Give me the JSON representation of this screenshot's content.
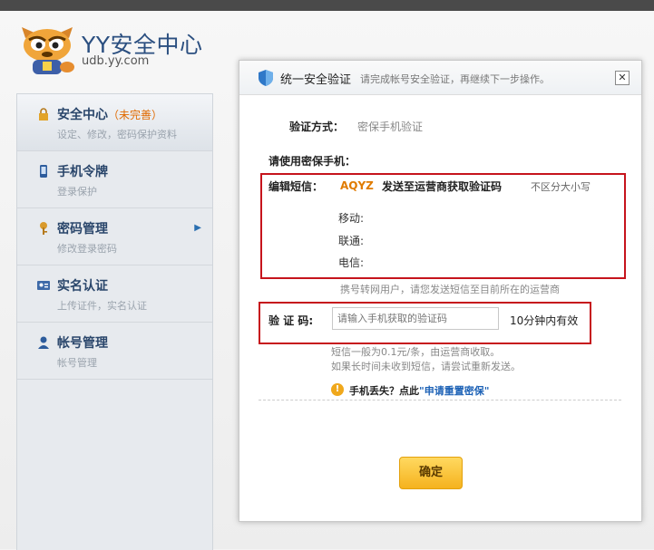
{
  "header": {
    "title": "YY安全中心",
    "url": "udb.yy.com"
  },
  "sidebar": {
    "items": [
      {
        "label": "安全中心",
        "tag": "（未完善）",
        "sub": "设定、修改，密码保护资料",
        "icon": "lock-icon",
        "active": true
      },
      {
        "label": "手机令牌",
        "tag": "",
        "sub": "登录保护",
        "icon": "phone-icon"
      },
      {
        "label": "密码管理",
        "tag": "",
        "sub": "修改登录密码",
        "icon": "key-icon",
        "arrow": "▶"
      },
      {
        "label": "实名认证",
        "tag": "",
        "sub": "上传证件，实名认证",
        "icon": "id-card-icon"
      },
      {
        "label": "帐号管理",
        "tag": "",
        "sub": "帐号管理",
        "icon": "user-icon"
      }
    ]
  },
  "dialog": {
    "title": "统一安全验证",
    "subtitle": "请完成帐号安全验证，再继续下一步操作。",
    "close": "✕",
    "method_label": "验证方式：",
    "method_value": "密保手机验证",
    "phone_label": "请使用密保手机：",
    "sms_label": "编辑短信：",
    "sms_code": "AQYZ",
    "sms_send": "发送至运营商获取验证码",
    "sms_nocase": "不区分大小写",
    "carriers": [
      "移动:",
      "联通:",
      "电信:"
    ],
    "carrier_note": "携号转网用户，请您发送短信至目前所在的运营商",
    "code_label": "验 证 码:",
    "code_placeholder": "请输入手机获取的验证码",
    "code_valid": "10分钟内有效",
    "fee_note": "短信一般为0.1元/条，由运营商收取。",
    "retry_note": "如果长时间未收到短信，请尝试重新发送。",
    "lost_prefix": "手机丢失？点此",
    "lost_link": "\"申请重置密保\"",
    "confirm": "确定"
  },
  "colors": {
    "highlight_box": "#c6141c",
    "code": "#e07b00",
    "link": "#1d62b6",
    "button": "#f5b21e"
  }
}
